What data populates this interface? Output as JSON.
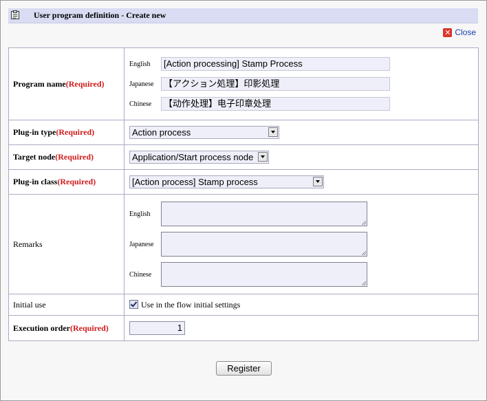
{
  "window": {
    "title": "User program definition - Create new",
    "close_label": "Close"
  },
  "program_name": {
    "label": "Program name",
    "required": "(Required)",
    "langs": {
      "english": {
        "label": "English",
        "value": "[Action processing] Stamp Process"
      },
      "japanese": {
        "label": "Japanese",
        "value": "【アクション処理】印影処理"
      },
      "chinese": {
        "label": "Chinese",
        "value": "【动作处理】电子印章处理"
      }
    }
  },
  "plugin_type": {
    "label": "Plug-in type",
    "required": "(Required)",
    "selected": "Action process"
  },
  "target_node": {
    "label": "Target node",
    "required": "(Required)",
    "selected": "Application/Start process node"
  },
  "plugin_class": {
    "label": "Plug-in class",
    "required": "(Required)",
    "selected": "[Action process] Stamp process"
  },
  "remarks": {
    "label": "Remarks",
    "langs": {
      "english": {
        "label": "English",
        "value": ""
      },
      "japanese": {
        "label": "Japanese",
        "value": ""
      },
      "chinese": {
        "label": "Chinese",
        "value": ""
      }
    }
  },
  "initial_use": {
    "label": "Initial use",
    "checkbox_label": "Use in the flow initial settings",
    "checked": true
  },
  "execution_order": {
    "label": "Execution order",
    "required": "(Required)",
    "value": "1"
  },
  "register_label": "Register"
}
